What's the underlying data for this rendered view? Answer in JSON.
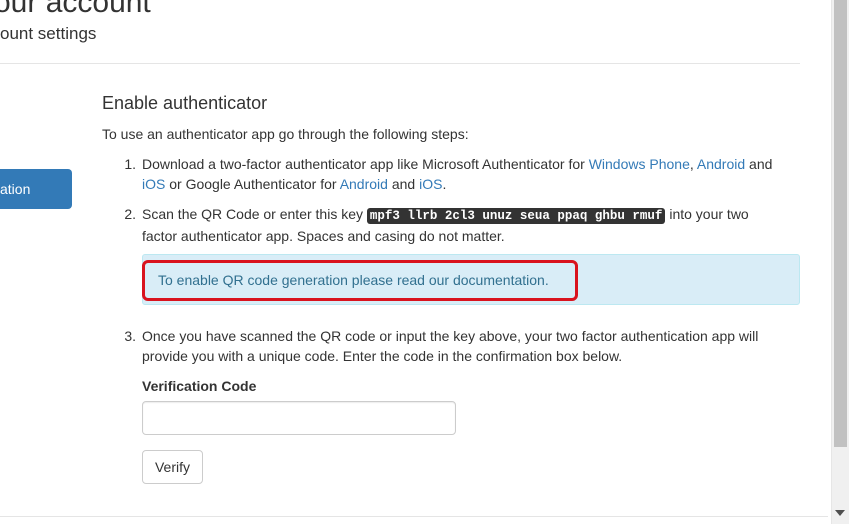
{
  "header": {
    "title": "our account",
    "subtitle": "ount settings"
  },
  "nav": {
    "active_label": "ation"
  },
  "section": {
    "heading": "Enable authenticator",
    "intro": "To use an authenticator app go through the following steps:"
  },
  "steps": [
    {
      "number": "1.",
      "text_a": "Download a two-factor authenticator app like Microsoft Authenticator for ",
      "link_windows_phone": "Windows Phone",
      "sep_comma": ", ",
      "link_android_1": "Android",
      "text_and_1": " and",
      "link_ios_1": "iOS",
      "text_b": " or Google Authenticator for ",
      "link_android_2": "Android",
      "text_and_2": " and ",
      "link_ios_2": "iOS",
      "text_end": "."
    },
    {
      "number": "2.",
      "text_a": "Scan the QR Code or enter this key ",
      "key": "mpf3 llrb 2cl3 unuz seua ppaq ghbu rmuf",
      "text_b": " into your two factor authenticator app. Spaces and casing do not matter."
    },
    {
      "number": "3.",
      "text": "Once you have scanned the QR code or input the key above, your two factor authentication app will provide you with a unique code. Enter the code in the confirmation box below."
    }
  ],
  "alert": {
    "text_a": "To enable QR code generation please read our ",
    "link": "documentation",
    "text_end": "."
  },
  "form": {
    "label": "Verification Code",
    "value": "",
    "button_label": "Verify"
  },
  "colors": {
    "link": "#337ab7",
    "primary": "#337ab7",
    "alert_bg": "#d9edf7",
    "highlight": "#d9131e"
  }
}
